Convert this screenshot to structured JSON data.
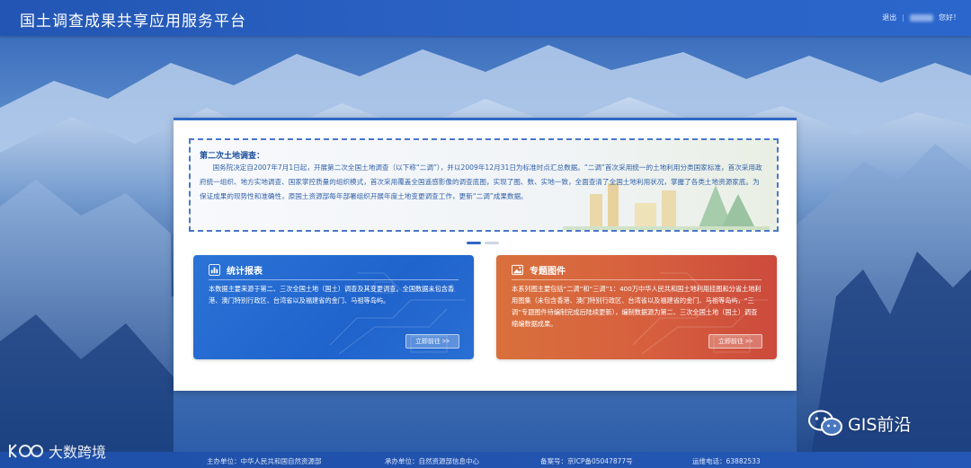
{
  "header": {
    "title": "国土调查成果共享应用服务平台",
    "logout_label": "退出",
    "separator": "|",
    "greeting": "您好！"
  },
  "intro": {
    "title": "第二次土地调查：",
    "text": "国务院决定自2007年7月1日起，开展第二次全国土地调查（以下称“二调”），并以2009年12月31日为标准时点汇总数据。“二调”首次采用统一的土地利用分类国家标准，首次采用政府统一组织、地方实地调查、国家掌控质量的组织模式，首次采用覆盖全国遥感影像的调查底图，实现了图、数、实地一致，全面查清了全国土地利用状况，掌握了各类土地资源家底。为保证成果的现势性和准确性，原国土资源部每年部署组织开展年度土地变更调查工作，更新“二调”成果数据。"
  },
  "cards": [
    {
      "title": "统计报表",
      "icon": "chart-report-icon",
      "text": "本数据主要来源于第二、三次全国土地（国土）调查及其变更调查。全国数据未包含香港、澳门特别行政区、台湾省以及福建省的金门、马祖等岛屿。",
      "button_label": "立即前往 >>",
      "colors": {
        "start": "#2b73d6",
        "end": "#1f63cc"
      }
    },
    {
      "title": "专题图件",
      "icon": "picture-map-icon",
      "text": "本系列图主要包括“二调”和“三调”1：400万中华人民共和国土地利用挂图和分省土地利用图集（未包含香港、澳门特别行政区、台湾省以及福建省的金门、马祖等岛屿，“三调”专题图件待编制完成后陆续更新），编制数据源为第二、三次全国土地（国土）调查缩编数据成果。",
      "button_label": "立即前往 >>",
      "colors": {
        "start": "#d9703c",
        "end": "#cc4a3c"
      }
    }
  ],
  "footer": {
    "host": "主办单位：中华人民共和国自然资源部",
    "organizer": "承办单位：自然资源部信息中心",
    "icp": "备案号：京ICP备05047877号",
    "tech_phone": "运维电话：63882533"
  },
  "watermarks": {
    "gis": "GIS前沿",
    "dsk": "大数跨境"
  },
  "colors": {
    "header": "#2356b4",
    "accent": "#2f68c7",
    "intro_text": "#2f5fa8"
  }
}
